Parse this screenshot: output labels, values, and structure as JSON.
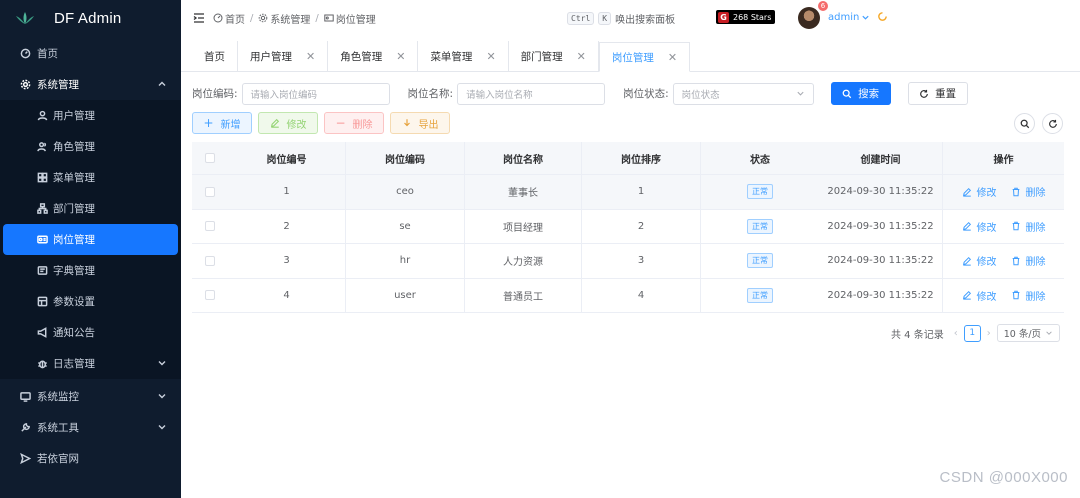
{
  "app": {
    "title": "DF Admin"
  },
  "sidebar": {
    "home": "首页",
    "system": "系统管理",
    "sub": [
      {
        "label": "用户管理",
        "icon": "user-icon"
      },
      {
        "label": "角色管理",
        "icon": "users-icon"
      },
      {
        "label": "菜单管理",
        "icon": "menu-icon"
      },
      {
        "label": "部门管理",
        "icon": "org-icon"
      },
      {
        "label": "岗位管理",
        "icon": "post-icon"
      },
      {
        "label": "字典管理",
        "icon": "book-icon"
      },
      {
        "label": "参数设置",
        "icon": "settings-icon"
      },
      {
        "label": "通知公告",
        "icon": "megaphone-icon"
      },
      {
        "label": "日志管理",
        "icon": "bug-icon"
      }
    ],
    "monitor": "系统监控",
    "tools": "系统工具",
    "official": "若依官网"
  },
  "header": {
    "breadcrumb": [
      "首页",
      "系统管理",
      "岗位管理"
    ],
    "kbd1": "Ctrl",
    "kbd2": "K",
    "search_hint": "唤出搜索面板",
    "stars": "268 Stars",
    "badge": "6",
    "user": "admin"
  },
  "tabs": [
    "首页",
    "用户管理",
    "角色管理",
    "菜单管理",
    "部门管理",
    "岗位管理"
  ],
  "search": {
    "code_label": "岗位编码:",
    "code_placeholder": "请输入岗位编码",
    "name_label": "岗位名称:",
    "name_placeholder": "请输入岗位名称",
    "status_label": "岗位状态:",
    "status_placeholder": "岗位状态",
    "search_btn": "搜索",
    "reset_btn": "重置"
  },
  "toolbar": {
    "add": "新增",
    "edit": "修改",
    "delete": "删除",
    "export": "导出"
  },
  "table": {
    "headers": [
      "岗位编号",
      "岗位编码",
      "岗位名称",
      "岗位排序",
      "状态",
      "创建时间",
      "操作"
    ],
    "rows": [
      {
        "id": "1",
        "code": "ceo",
        "name": "董事长",
        "sort": "1",
        "status": "正常",
        "created": "2024-09-30 11:35:22"
      },
      {
        "id": "2",
        "code": "se",
        "name": "项目经理",
        "sort": "2",
        "status": "正常",
        "created": "2024-09-30 11:35:22"
      },
      {
        "id": "3",
        "code": "hr",
        "name": "人力资源",
        "sort": "3",
        "status": "正常",
        "created": "2024-09-30 11:35:22"
      },
      {
        "id": "4",
        "code": "user",
        "name": "普通员工",
        "sort": "4",
        "status": "正常",
        "created": "2024-09-30 11:35:22"
      }
    ],
    "edit_label": "修改",
    "delete_label": "删除"
  },
  "pagination": {
    "total": "共 4 条记录",
    "page": "1",
    "size": "10 条/页"
  },
  "watermark": "CSDN @000X000",
  "colors": {
    "sidebar_bg": "#0f1c2e",
    "primary": "#1677ff",
    "link": "#409eff"
  }
}
